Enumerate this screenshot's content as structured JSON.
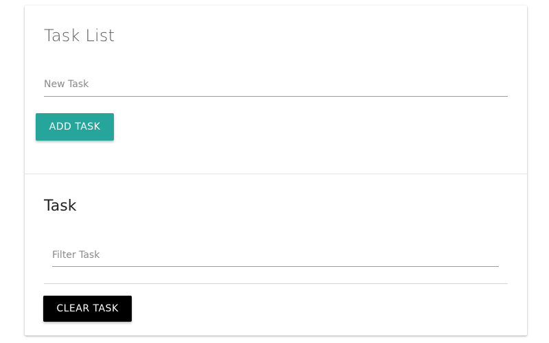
{
  "task_list": {
    "title": "Task List",
    "new_task_input": {
      "value": "",
      "placeholder": "New Task"
    },
    "add_button_label": "ADD TASK"
  },
  "tasks": {
    "title": "Task",
    "filter_input": {
      "value": "",
      "placeholder": "Filter Task"
    },
    "items": [],
    "clear_button_label": "CLEAR TASK"
  },
  "colors": {
    "add_button": "#26a69a",
    "clear_button": "#000000"
  }
}
